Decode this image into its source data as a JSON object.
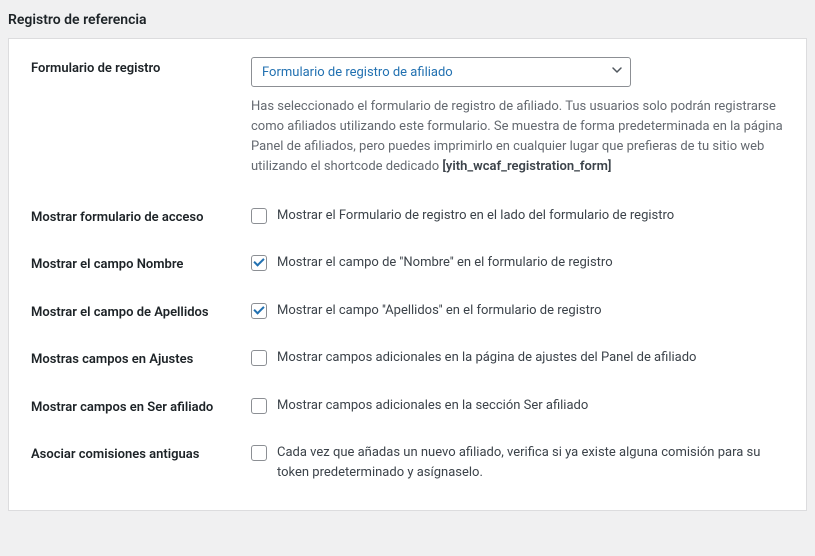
{
  "section_title": "Registro de referencia",
  "rows": {
    "registration_form": {
      "label": "Formulario de registro",
      "select_value": "Formulario de registro de afiliado",
      "help_prefix": "Has seleccionado el formulario de registro de afiliado. Tus usuarios solo podrán registrarse como afiliados utilizando este formulario. Se muestra de forma predeterminada en la página Panel de afiliados, pero puedes imprimirlo en cualquier lugar que prefieras de tu sitio web utilizando el shortcode dedicado ",
      "shortcode": "[yith_wcaf_registration_form]"
    },
    "show_login": {
      "label": "Mostrar formulario de acceso",
      "desc": "Mostrar el Formulario de registro en el lado del formulario de registro",
      "checked": false
    },
    "show_name": {
      "label": "Mostrar el campo Nombre",
      "desc": "Mostrar el campo de ''Nombre'' en el formulario de registro",
      "checked": true
    },
    "show_surname": {
      "label": "Mostrar el campo de Apellidos",
      "desc": "Mostrar el campo ''Apellidos'' en el formulario de registro",
      "checked": true
    },
    "show_settings_fields": {
      "label": "Mostras campos en Ajustes",
      "desc": "Mostrar campos adicionales en la página de ajustes del Panel de afiliado",
      "checked": false
    },
    "show_affiliate_fields": {
      "label": "Mostrar campos en Ser afiliado",
      "desc": "Mostrar campos adicionales en la sección Ser afiliado",
      "checked": false
    },
    "associate_commissions": {
      "label": "Asociar comisiones antiguas",
      "desc": "Cada vez que añadas un nuevo afiliado, verifica si ya existe alguna comisión para su token predeterminado y asígnaselo.",
      "checked": false
    }
  }
}
